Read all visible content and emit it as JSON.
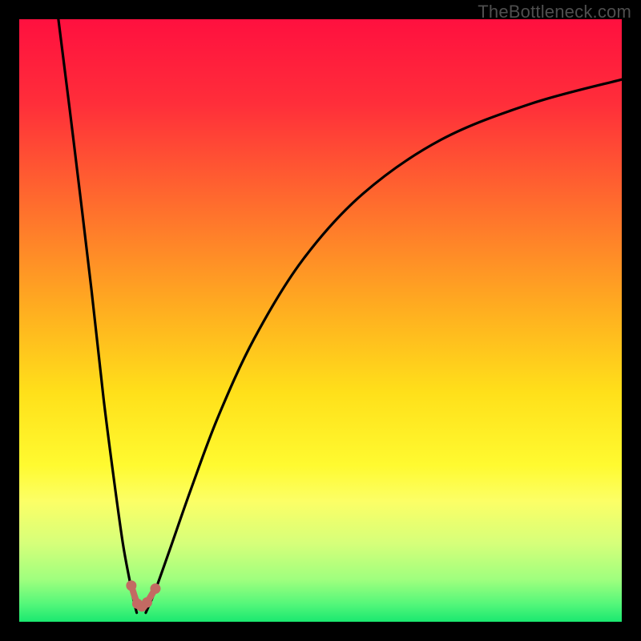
{
  "watermark": {
    "text": "TheBottleneck.com"
  },
  "chart_data": {
    "type": "line",
    "title": "",
    "xlabel": "",
    "ylabel": "",
    "x_range": [
      0,
      100
    ],
    "y_range": [
      0,
      100
    ],
    "gradient_stops": [
      {
        "offset": 0,
        "color": "#ff103f"
      },
      {
        "offset": 0.14,
        "color": "#ff2e3a"
      },
      {
        "offset": 0.3,
        "color": "#ff6a2e"
      },
      {
        "offset": 0.48,
        "color": "#ffad20"
      },
      {
        "offset": 0.62,
        "color": "#ffe01a"
      },
      {
        "offset": 0.74,
        "color": "#fffa30"
      },
      {
        "offset": 0.8,
        "color": "#fcff66"
      },
      {
        "offset": 0.87,
        "color": "#d6ff7a"
      },
      {
        "offset": 0.93,
        "color": "#9fff7e"
      },
      {
        "offset": 0.97,
        "color": "#55f77a"
      },
      {
        "offset": 1.0,
        "color": "#1ae870"
      }
    ],
    "series": [
      {
        "name": "left-branch",
        "x": [
          6.5,
          9.0,
          12.0,
          14.0,
          15.8,
          17.2,
          18.3,
          19.0,
          19.5
        ],
        "y": [
          100,
          80,
          55,
          37,
          23,
          13,
          7,
          3.5,
          1.5
        ]
      },
      {
        "name": "right-branch",
        "x": [
          21.0,
          22.5,
          25.0,
          28.5,
          33.0,
          39.0,
          47.0,
          57.0,
          70.0,
          85.0,
          100.0
        ],
        "y": [
          1.5,
          5.0,
          12.0,
          22.0,
          34.0,
          47.0,
          60.0,
          71.0,
          80.0,
          86.0,
          90.0
        ]
      }
    ],
    "markers": [
      {
        "x": 18.6,
        "y": 6.0,
        "r": 6.5,
        "color": "#c36a63"
      },
      {
        "x": 19.6,
        "y": 3.0,
        "r": 6.5,
        "color": "#c36a63"
      },
      {
        "x": 21.2,
        "y": 3.2,
        "r": 6.5,
        "color": "#c36a63"
      },
      {
        "x": 22.6,
        "y": 5.5,
        "r": 6.5,
        "color": "#c36a63"
      }
    ],
    "connector": {
      "points": [
        {
          "x": 18.6,
          "y": 6.0
        },
        {
          "x": 19.6,
          "y": 3.0
        },
        {
          "x": 20.4,
          "y": 2.2
        },
        {
          "x": 21.2,
          "y": 3.2
        },
        {
          "x": 22.6,
          "y": 5.5
        }
      ],
      "color": "#c36a63",
      "width": 8
    }
  }
}
